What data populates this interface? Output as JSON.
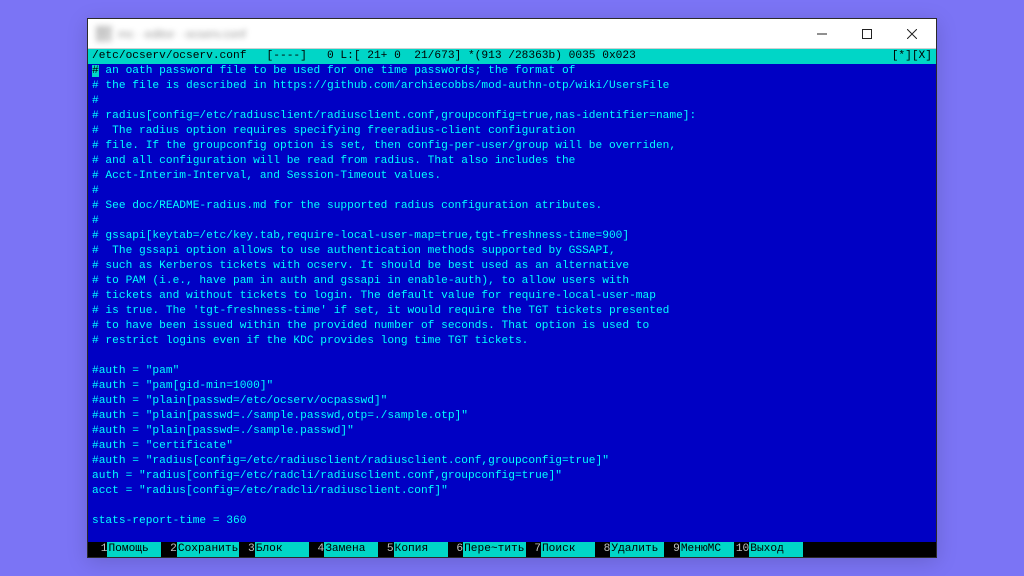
{
  "titlebar": {
    "title": "mc · editor · ocserv.conf"
  },
  "status": {
    "left": "/etc/ocserv/ocserv.conf   [----]   0 L:[ 21+ 0  21/673] *(913 /28363b) 0035 0x023",
    "right": "[*][X]"
  },
  "editor": {
    "lines": [
      "# an oath password file to be used for one time passwords; the format of",
      "# the file is described in https://github.com/archiecobbs/mod-authn-otp/wiki/UsersFile",
      "#",
      "# radius[config=/etc/radiusclient/radiusclient.conf,groupconfig=true,nas-identifier=name]:",
      "#  The radius option requires specifying freeradius-client configuration",
      "# file. If the groupconfig option is set, then config-per-user/group will be overriden,",
      "# and all configuration will be read from radius. That also includes the",
      "# Acct-Interim-Interval, and Session-Timeout values.",
      "#",
      "# See doc/README-radius.md for the supported radius configuration atributes.",
      "#",
      "# gssapi[keytab=/etc/key.tab,require-local-user-map=true,tgt-freshness-time=900]",
      "#  The gssapi option allows to use authentication methods supported by GSSAPI,",
      "# such as Kerberos tickets with ocserv. It should be best used as an alternative",
      "# to PAM (i.e., have pam in auth and gssapi in enable-auth), to allow users with",
      "# tickets and without tickets to login. The default value for require-local-user-map",
      "# is true. The 'tgt-freshness-time' if set, it would require the TGT tickets presented",
      "# to have been issued within the provided number of seconds. That option is used to",
      "# restrict logins even if the KDC provides long time TGT tickets.",
      "",
      "#auth = \"pam\"",
      "#auth = \"pam[gid-min=1000]\"",
      "#auth = \"plain[passwd=/etc/ocserv/ocpasswd]\"",
      "#auth = \"plain[passwd=./sample.passwd,otp=./sample.otp]\"",
      "#auth = \"plain[passwd=./sample.passwd]\"",
      "#auth = \"certificate\"",
      "#auth = \"radius[config=/etc/radiusclient/radiusclient.conf,groupconfig=true]\"",
      "auth = \"radius[config=/etc/radcli/radiusclient.conf,groupconfig=true]\"",
      "acct = \"radius[config=/etc/radcli/radiusclient.conf]\"",
      "",
      "stats-report-time = 360",
      ""
    ]
  },
  "fkeys": [
    {
      "n": "1",
      "label": "Помощь"
    },
    {
      "n": "2",
      "label": "Сохранить"
    },
    {
      "n": "3",
      "label": "Блок"
    },
    {
      "n": "4",
      "label": "Замена"
    },
    {
      "n": "5",
      "label": "Копия"
    },
    {
      "n": "6",
      "label": "Пере~тить"
    },
    {
      "n": "7",
      "label": "Поиск"
    },
    {
      "n": "8",
      "label": "Удалить"
    },
    {
      "n": "9",
      "label": "МенюMC"
    },
    {
      "n": "10",
      "label": "Выход"
    }
  ]
}
